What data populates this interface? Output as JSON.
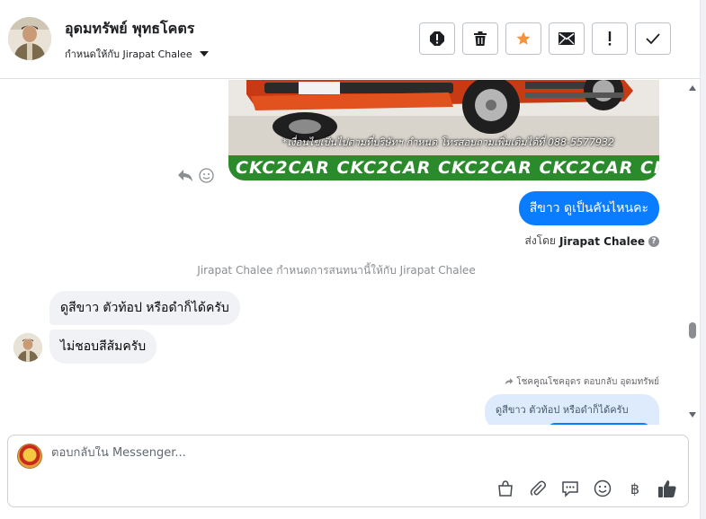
{
  "header": {
    "contact_name": "อุดมทรัพย์ พุทธโคตร",
    "assigned_to_label": "กำหนดให้กับ Jirapat Chalee",
    "actions": [
      {
        "name": "report-button",
        "icon": "alert-icon"
      },
      {
        "name": "delete-button",
        "icon": "trash-icon"
      },
      {
        "name": "star-button",
        "icon": "star-icon"
      },
      {
        "name": "mark-unread-button",
        "icon": "envelope-icon"
      },
      {
        "name": "follow-up-button",
        "icon": "exclamation-icon"
      },
      {
        "name": "mark-done-button",
        "icon": "check-icon"
      }
    ]
  },
  "chat": {
    "image_caption": "*เงื่อนไขเป็นไปตามที่บริษัทฯ กำหนด โทรสอบถามเพิ่มเติมได้ที่ 088-5577932",
    "image_banner": "CKC2CAR CKC2CAR CKC2CAR CKC2CAR CKC2",
    "outgoing_message": "สีขาว ดูเป็นคันไหนคะ",
    "sent_by_prefix": "ส่งโดย",
    "sent_by_name": "Jirapat Chalee",
    "system_note": "Jirapat Chalee กำหนดการสนทนานี้ให้กับ Jirapat Chalee",
    "incoming_messages": [
      "ดูสีขาว  ตัวท้อป   หรือดำก็ได้ครับ",
      "ไม่ชอบสีส้มครับ"
    ],
    "reply_note": "โชคคูณโชคอุดร ตอบกลับ อุดมทรัพย์",
    "quoted_text": "ดูสีขาว ตัวท้อป หรือดำก็ได้ครับ"
  },
  "composer": {
    "placeholder": "ตอบกลับใน Messenger...",
    "tools": [
      "shopping-bag-icon",
      "paperclip-icon",
      "saved-reply-icon",
      "emoji-icon",
      "baht-icon",
      "thumbs-up-icon"
    ],
    "baht_symbol": "฿"
  },
  "colors": {
    "accent": "#0a7cff",
    "star": "#f7923a",
    "quoted_bg": "#deebfc",
    "incoming_bg": "#f0f2f5"
  }
}
